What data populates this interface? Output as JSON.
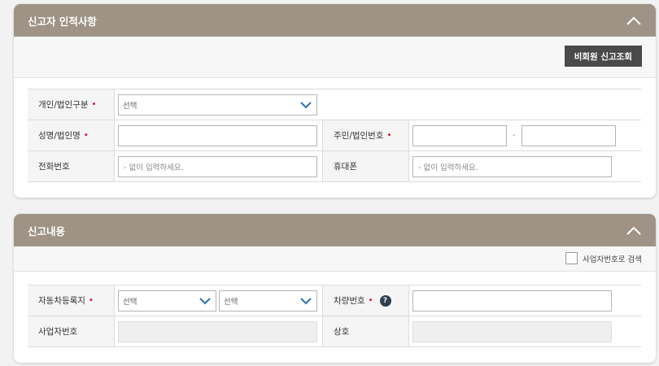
{
  "section1": {
    "title": "신고자 인적사항",
    "lookup_button": "비회원 신고조회",
    "rows": {
      "type_label": "개인/법인구분",
      "type_select": "선택",
      "name_label": "성명/법인명",
      "id_label": "주민/법인번호",
      "id_dash": "-",
      "phone_label": "전화번호",
      "phone_placeholder": "- 없이 입력하세요.",
      "mobile_label": "휴대폰",
      "mobile_placeholder": "- 없이 입력하세요."
    },
    "required_mark": "•"
  },
  "section2": {
    "title": "신고내용",
    "search_by_business_label": "사업자번호로 검색",
    "rows": {
      "registration_label": "자동차등록지",
      "registration_select1": "선택",
      "registration_select2": "선택",
      "vehicle_no_label": "차량번호",
      "business_no_label": "사업자번호",
      "company_label": "상호"
    },
    "help_icon": "?"
  },
  "icons": {
    "collapse": "chevron-up-icon",
    "dropdown": "chevron-down-icon",
    "help": "question-circle-icon"
  },
  "colors": {
    "header_bg": "#9e9384",
    "button_bg": "#4a4a4a",
    "required": "#d0021b",
    "chevron": "#2f6ea8"
  }
}
